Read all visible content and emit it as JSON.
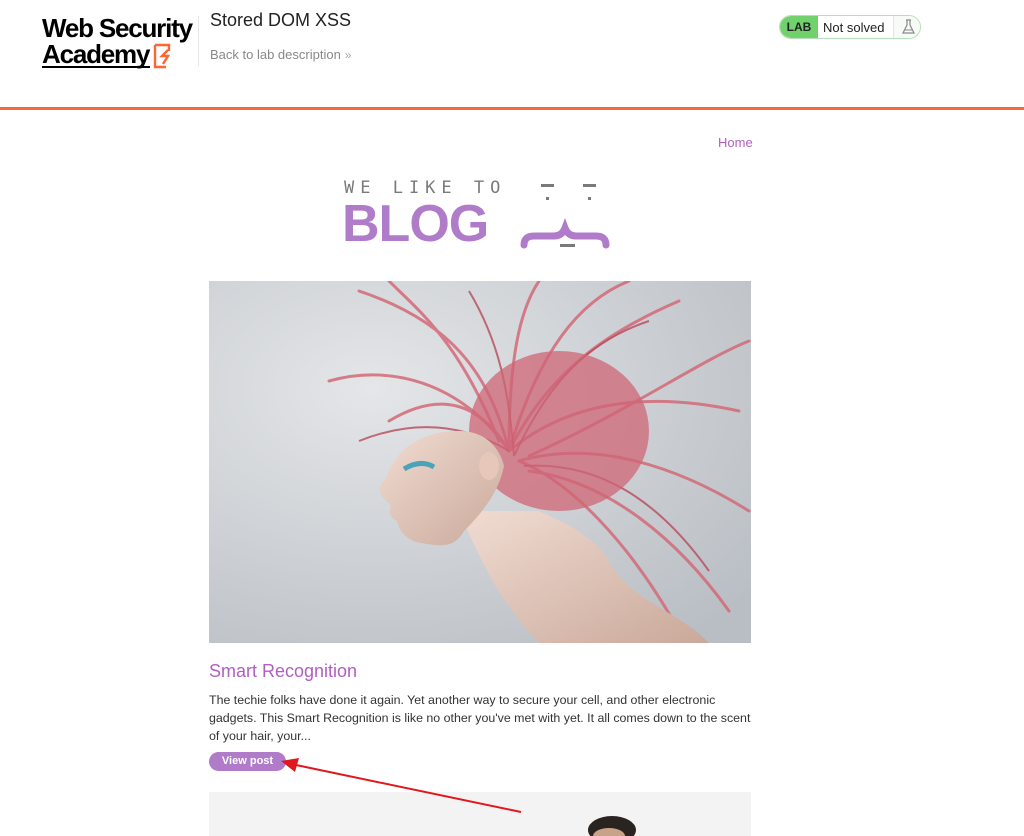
{
  "academy": {
    "logo_line1": "Web Security",
    "logo_line2": "Academy",
    "lab_title": "Stored DOM XSS",
    "back_link": "Back to lab description",
    "back_icon": "double-chevron-right-icon",
    "lab_badge": "LAB",
    "lab_status": "Not solved",
    "flask_icon": "flask-icon",
    "accent_color": "#ff6633",
    "status_color": "#70d16d"
  },
  "nav": {
    "home": "Home"
  },
  "banner": {
    "small_text": "WE LIKE TO",
    "big_text": "BLOG"
  },
  "posts": [
    {
      "title": "Smart Recognition",
      "summary": "The techie folks have done it again. Yet another way to secure your cell, and other electronic gadgets. This Smart Recognition is like no other you've met with yet. It all comes down to the scent of your hair, your...",
      "button": "View post",
      "image": "woman-with-pink-hair-photo"
    },
    {
      "image": "man-in-white-photo"
    }
  ],
  "theme": {
    "link_color": "#b05fc0",
    "button_color": "#b07bc9",
    "annotation_color": "#e0171d"
  }
}
